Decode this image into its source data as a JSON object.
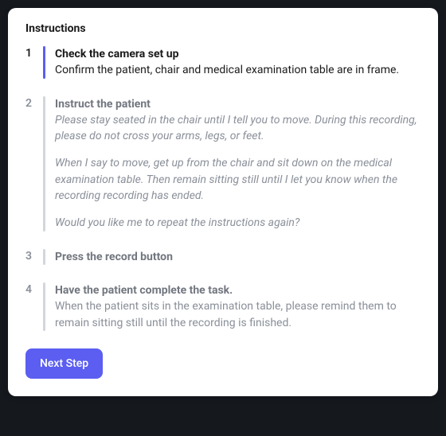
{
  "heading": "Instructions",
  "steps": [
    {
      "num": "1",
      "title": "Check the camera set up",
      "desc": "Confirm the patient, chair and medical examination table are in frame.",
      "active": true
    },
    {
      "num": "2",
      "title": "Instruct the patient",
      "para1": "Please stay seated in the chair until I tell you to move. During this recording, please do not cross your arms, legs, or feet.",
      "para2": "When I say to move, get up from the chair and sit down on the medical examination table. Then remain sitting still until I let you know when the recording recording has ended.",
      "para3": "Would you like me to repeat the instructions again?",
      "active": false
    },
    {
      "num": "3",
      "title": "Press the record button",
      "active": false
    },
    {
      "num": "4",
      "title": "Have the patient complete the task.",
      "desc": "When the patient sits in the examination table, please remind them to remain sitting still until the recording is finished.",
      "active": false
    }
  ],
  "button_label": "Next Step"
}
